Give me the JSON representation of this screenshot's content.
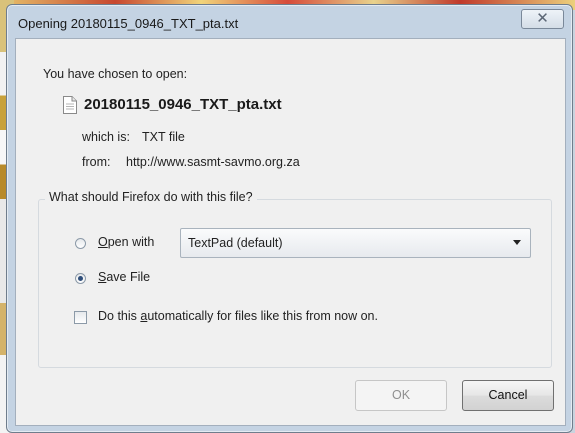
{
  "window": {
    "title": "Opening 20180115_0946_TXT_pta.txt",
    "close_glyph": "✕"
  },
  "content": {
    "intro": "You have chosen to open:",
    "filename": "20180115_0946_TXT_pta.txt",
    "file_icon": "document-icon",
    "which_is_label": "which is:",
    "which_is_value": "TXT file",
    "from_label": "from:",
    "from_value": "http://www.sasmt-savmo.org.za"
  },
  "action_group": {
    "legend": "What should Firefox do with this file?",
    "open_with": {
      "key": "O",
      "rest": "pen with",
      "checked": false
    },
    "open_with_app": "TextPad (default)",
    "save_file": {
      "key": "S",
      "rest": "ave File",
      "checked": true
    },
    "auto_checkbox": {
      "before": "Do this ",
      "key": "a",
      "after": "utomatically for files like this from now on.",
      "checked": false
    }
  },
  "buttons": {
    "ok_label": "OK",
    "ok_enabled": false,
    "cancel_label": "Cancel"
  }
}
